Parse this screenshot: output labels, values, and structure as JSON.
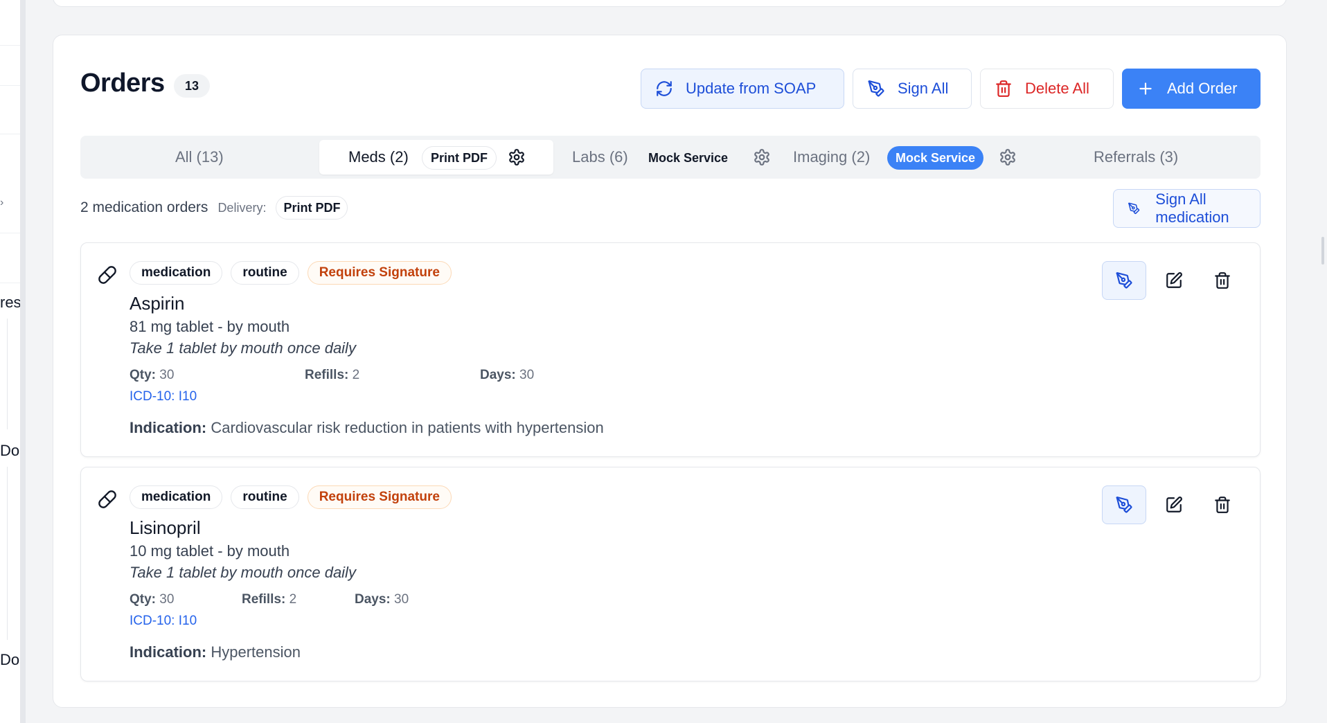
{
  "sidebar_fragments": [
    "res",
    "Do",
    "Do"
  ],
  "orders": {
    "title": "Orders",
    "count": "13",
    "buttons": {
      "update_soap": "Update from SOAP",
      "sign_all": "Sign All",
      "delete_all": "Delete All",
      "add_order": "Add Order"
    },
    "tabs": {
      "all": "All (13)",
      "meds": "Meds (2)",
      "meds_delivery": "Print PDF",
      "labs": "Labs (6)",
      "labs_service": "Mock Service",
      "imaging": "Imaging (2)",
      "imaging_service": "Mock Service",
      "referrals": "Referrals (3)"
    },
    "summary": {
      "text": "2 medication orders",
      "delivery_label": "Delivery:",
      "delivery_value": "Print PDF",
      "sign_all_med": "Sign All medication"
    },
    "items": [
      {
        "tags": [
          "medication",
          "routine",
          "Requires Signature"
        ],
        "name": "Aspirin",
        "dose": "81 mg tablet - by mouth",
        "sig": "Take 1 tablet by mouth once daily",
        "qty_label": "Qty:",
        "qty": "30",
        "refills_label": "Refills:",
        "refills": "2",
        "days_label": "Days:",
        "days": "30",
        "icd": "ICD-10: I10",
        "indication_label": "Indication:",
        "indication": "Cardiovascular risk reduction in patients with hypertension"
      },
      {
        "tags": [
          "medication",
          "routine",
          "Requires Signature"
        ],
        "name": "Lisinopril",
        "dose": "10 mg tablet - by mouth",
        "sig": "Take 1 tablet by mouth once daily",
        "qty_label": "Qty:",
        "qty": "30",
        "refills_label": "Refills:",
        "refills": "2",
        "days_label": "Days:",
        "days": "30",
        "icd": "ICD-10: I10",
        "indication_label": "Indication:",
        "indication": "Hypertension"
      }
    ]
  },
  "colors": {
    "primary": "#3b82f6",
    "primary_text": "#1d4ed8",
    "danger": "#dc2626",
    "warning": "#c2410c",
    "link": "#2563eb"
  }
}
